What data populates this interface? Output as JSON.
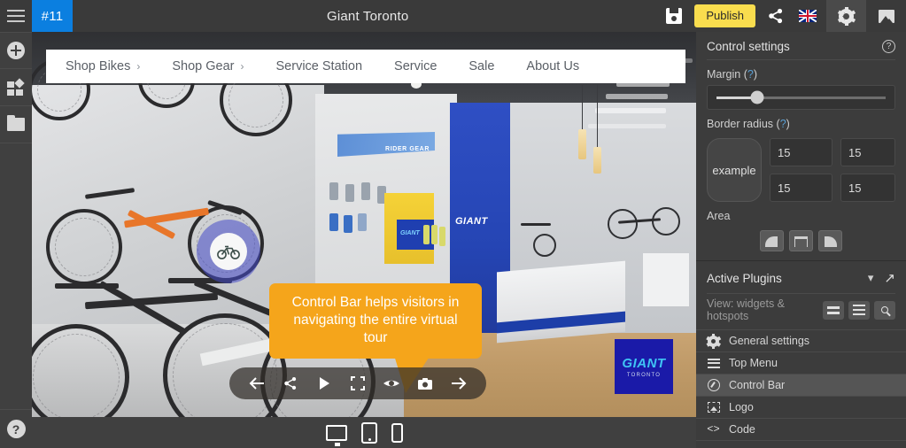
{
  "topbar": {
    "menu_icon": "hamburger-icon",
    "scene_badge": "#11",
    "title": "Giant Toronto",
    "save_icon": "save-icon",
    "publish_label": "Publish",
    "share_icon": "share-icon",
    "language_icon": "uk-flag-icon",
    "settings_tab_icon": "gear-icon",
    "media_tab_icon": "image-icon"
  },
  "leftrail": {
    "items": [
      {
        "name": "add-button",
        "icon": "plus-circle-icon"
      },
      {
        "name": "plugins-button",
        "icon": "puzzle-icon"
      },
      {
        "name": "files-button",
        "icon": "folder-icon"
      }
    ],
    "help_label": "?"
  },
  "viewer": {
    "topmenu": [
      {
        "label": "Shop Bikes",
        "chevron": "›"
      },
      {
        "label": "Shop Gear",
        "chevron": "›"
      },
      {
        "label": "Service Station",
        "chevron": ""
      },
      {
        "label": "Service",
        "chevron": ""
      },
      {
        "label": "Sale",
        "chevron": ""
      },
      {
        "label": "About Us",
        "chevron": ""
      }
    ],
    "hotspot_icon": "bicycle-icon",
    "callout_text": "Control Bar helps visitors in navigating the entire virtual tour",
    "signage": {
      "rider_gear": "RIDER GEAR",
      "giant_wall": "GIANT",
      "product_box": "GIANT"
    },
    "logo_plugin": {
      "line1": "GIANT",
      "line2": "TORONTO"
    },
    "controlbar": [
      {
        "name": "previous-scene-button",
        "icon": "arrow-left-icon"
      },
      {
        "name": "share-button",
        "icon": "share-icon"
      },
      {
        "name": "play-button",
        "icon": "play-icon"
      },
      {
        "name": "fullscreen-button",
        "icon": "fullscreen-icon"
      },
      {
        "name": "view-button",
        "icon": "eye-icon"
      },
      {
        "name": "snapshot-button",
        "icon": "camera-icon"
      },
      {
        "name": "next-scene-button",
        "icon": "arrow-right-icon"
      }
    ]
  },
  "devicebar": [
    {
      "name": "desktop-preview-button",
      "icon": "desktop-icon"
    },
    {
      "name": "tablet-preview-button",
      "icon": "tablet-icon"
    },
    {
      "name": "mobile-preview-button",
      "icon": "mobile-icon"
    }
  ],
  "control_settings": {
    "title": "Control settings",
    "help_label": "?",
    "margin": {
      "label": "Margin",
      "hint": "?",
      "value_percent": 24
    },
    "border_radius": {
      "label": "Border radius",
      "hint": "?",
      "top_left": "15",
      "top_right": "15",
      "bottom_left": "15",
      "bottom_right": "15",
      "example_label": "example"
    },
    "area": {
      "label": "Area",
      "options": [
        {
          "name": "area-left-button",
          "icon": "corner-left-icon"
        },
        {
          "name": "area-center-button",
          "icon": "bar-top-icon"
        },
        {
          "name": "area-right-button",
          "icon": "corner-right-icon"
        }
      ]
    }
  },
  "active_plugins": {
    "title": "Active Plugins",
    "collapse_icon": "chevron-down-icon",
    "expand_icon": "arrow-up-right-icon",
    "view_label": "View: widgets & hotspots",
    "view_buttons": [
      {
        "name": "view-compact-button",
        "icon": "list-compact-icon"
      },
      {
        "name": "view-detailed-button",
        "icon": "list-detailed-icon"
      },
      {
        "name": "plugin-search-button",
        "icon": "search-icon"
      }
    ],
    "items": [
      {
        "label": "General settings",
        "icon": "gear-icon",
        "selected": false
      },
      {
        "label": "Top Menu",
        "icon": "lines-icon",
        "selected": false
      },
      {
        "label": "Control Bar",
        "icon": "compass-icon",
        "selected": true
      },
      {
        "label": "Logo",
        "icon": "logo-icon",
        "selected": false
      },
      {
        "label": "Code",
        "icon": "code-icon",
        "selected": false
      }
    ]
  },
  "colors": {
    "accent_blue": "#0b7fe0",
    "publish_yellow": "#f9dd4e",
    "callout_orange": "#f5a51b",
    "panel_bg": "#3c3c3c",
    "brand_blue": "#1a1aa8"
  }
}
